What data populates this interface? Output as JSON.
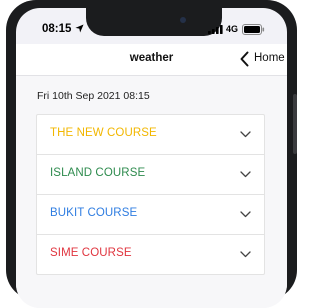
{
  "status_bar": {
    "time": "08:15",
    "network": "4G"
  },
  "nav": {
    "title": "weather",
    "back_label": "Home"
  },
  "date": "Fri 10th Sep 2021 08:15",
  "courses": [
    {
      "name": "THE NEW COURSE",
      "color": "#f2b700"
    },
    {
      "name": "ISLAND COURSE",
      "color": "#2e8b4e"
    },
    {
      "name": "BUKIT COURSE",
      "color": "#2f7de1"
    },
    {
      "name": "SIME COURSE",
      "color": "#e0353f"
    }
  ]
}
